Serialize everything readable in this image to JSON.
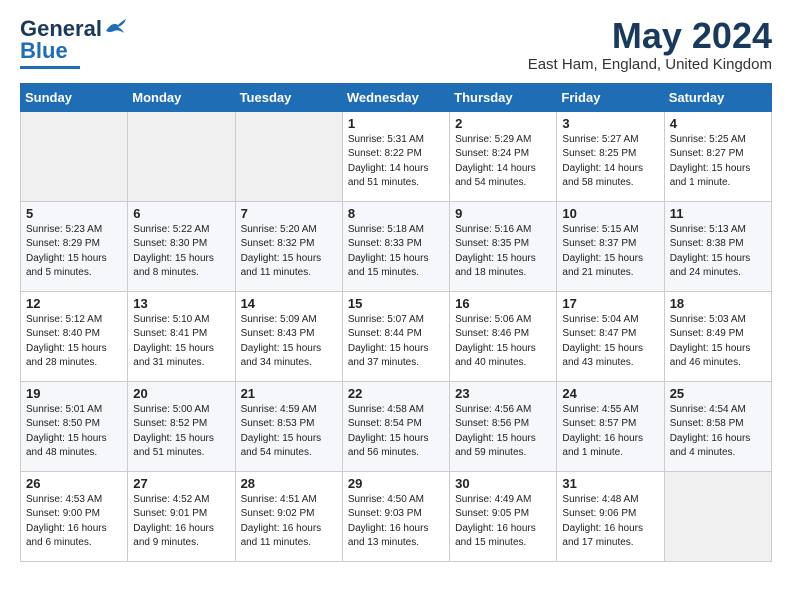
{
  "logo": {
    "line1": "General",
    "line2": "Blue"
  },
  "title": "May 2024",
  "location": "East Ham, England, United Kingdom",
  "days_of_week": [
    "Sunday",
    "Monday",
    "Tuesday",
    "Wednesday",
    "Thursday",
    "Friday",
    "Saturday"
  ],
  "weeks": [
    [
      {
        "day": "",
        "sunrise": "",
        "sunset": "",
        "daylight": ""
      },
      {
        "day": "",
        "sunrise": "",
        "sunset": "",
        "daylight": ""
      },
      {
        "day": "",
        "sunrise": "",
        "sunset": "",
        "daylight": ""
      },
      {
        "day": "1",
        "sunrise": "Sunrise: 5:31 AM",
        "sunset": "Sunset: 8:22 PM",
        "daylight": "Daylight: 14 hours and 51 minutes."
      },
      {
        "day": "2",
        "sunrise": "Sunrise: 5:29 AM",
        "sunset": "Sunset: 8:24 PM",
        "daylight": "Daylight: 14 hours and 54 minutes."
      },
      {
        "day": "3",
        "sunrise": "Sunrise: 5:27 AM",
        "sunset": "Sunset: 8:25 PM",
        "daylight": "Daylight: 14 hours and 58 minutes."
      },
      {
        "day": "4",
        "sunrise": "Sunrise: 5:25 AM",
        "sunset": "Sunset: 8:27 PM",
        "daylight": "Daylight: 15 hours and 1 minute."
      }
    ],
    [
      {
        "day": "5",
        "sunrise": "Sunrise: 5:23 AM",
        "sunset": "Sunset: 8:29 PM",
        "daylight": "Daylight: 15 hours and 5 minutes."
      },
      {
        "day": "6",
        "sunrise": "Sunrise: 5:22 AM",
        "sunset": "Sunset: 8:30 PM",
        "daylight": "Daylight: 15 hours and 8 minutes."
      },
      {
        "day": "7",
        "sunrise": "Sunrise: 5:20 AM",
        "sunset": "Sunset: 8:32 PM",
        "daylight": "Daylight: 15 hours and 11 minutes."
      },
      {
        "day": "8",
        "sunrise": "Sunrise: 5:18 AM",
        "sunset": "Sunset: 8:33 PM",
        "daylight": "Daylight: 15 hours and 15 minutes."
      },
      {
        "day": "9",
        "sunrise": "Sunrise: 5:16 AM",
        "sunset": "Sunset: 8:35 PM",
        "daylight": "Daylight: 15 hours and 18 minutes."
      },
      {
        "day": "10",
        "sunrise": "Sunrise: 5:15 AM",
        "sunset": "Sunset: 8:37 PM",
        "daylight": "Daylight: 15 hours and 21 minutes."
      },
      {
        "day": "11",
        "sunrise": "Sunrise: 5:13 AM",
        "sunset": "Sunset: 8:38 PM",
        "daylight": "Daylight: 15 hours and 24 minutes."
      }
    ],
    [
      {
        "day": "12",
        "sunrise": "Sunrise: 5:12 AM",
        "sunset": "Sunset: 8:40 PM",
        "daylight": "Daylight: 15 hours and 28 minutes."
      },
      {
        "day": "13",
        "sunrise": "Sunrise: 5:10 AM",
        "sunset": "Sunset: 8:41 PM",
        "daylight": "Daylight: 15 hours and 31 minutes."
      },
      {
        "day": "14",
        "sunrise": "Sunrise: 5:09 AM",
        "sunset": "Sunset: 8:43 PM",
        "daylight": "Daylight: 15 hours and 34 minutes."
      },
      {
        "day": "15",
        "sunrise": "Sunrise: 5:07 AM",
        "sunset": "Sunset: 8:44 PM",
        "daylight": "Daylight: 15 hours and 37 minutes."
      },
      {
        "day": "16",
        "sunrise": "Sunrise: 5:06 AM",
        "sunset": "Sunset: 8:46 PM",
        "daylight": "Daylight: 15 hours and 40 minutes."
      },
      {
        "day": "17",
        "sunrise": "Sunrise: 5:04 AM",
        "sunset": "Sunset: 8:47 PM",
        "daylight": "Daylight: 15 hours and 43 minutes."
      },
      {
        "day": "18",
        "sunrise": "Sunrise: 5:03 AM",
        "sunset": "Sunset: 8:49 PM",
        "daylight": "Daylight: 15 hours and 46 minutes."
      }
    ],
    [
      {
        "day": "19",
        "sunrise": "Sunrise: 5:01 AM",
        "sunset": "Sunset: 8:50 PM",
        "daylight": "Daylight: 15 hours and 48 minutes."
      },
      {
        "day": "20",
        "sunrise": "Sunrise: 5:00 AM",
        "sunset": "Sunset: 8:52 PM",
        "daylight": "Daylight: 15 hours and 51 minutes."
      },
      {
        "day": "21",
        "sunrise": "Sunrise: 4:59 AM",
        "sunset": "Sunset: 8:53 PM",
        "daylight": "Daylight: 15 hours and 54 minutes."
      },
      {
        "day": "22",
        "sunrise": "Sunrise: 4:58 AM",
        "sunset": "Sunset: 8:54 PM",
        "daylight": "Daylight: 15 hours and 56 minutes."
      },
      {
        "day": "23",
        "sunrise": "Sunrise: 4:56 AM",
        "sunset": "Sunset: 8:56 PM",
        "daylight": "Daylight: 15 hours and 59 minutes."
      },
      {
        "day": "24",
        "sunrise": "Sunrise: 4:55 AM",
        "sunset": "Sunset: 8:57 PM",
        "daylight": "Daylight: 16 hours and 1 minute."
      },
      {
        "day": "25",
        "sunrise": "Sunrise: 4:54 AM",
        "sunset": "Sunset: 8:58 PM",
        "daylight": "Daylight: 16 hours and 4 minutes."
      }
    ],
    [
      {
        "day": "26",
        "sunrise": "Sunrise: 4:53 AM",
        "sunset": "Sunset: 9:00 PM",
        "daylight": "Daylight: 16 hours and 6 minutes."
      },
      {
        "day": "27",
        "sunrise": "Sunrise: 4:52 AM",
        "sunset": "Sunset: 9:01 PM",
        "daylight": "Daylight: 16 hours and 9 minutes."
      },
      {
        "day": "28",
        "sunrise": "Sunrise: 4:51 AM",
        "sunset": "Sunset: 9:02 PM",
        "daylight": "Daylight: 16 hours and 11 minutes."
      },
      {
        "day": "29",
        "sunrise": "Sunrise: 4:50 AM",
        "sunset": "Sunset: 9:03 PM",
        "daylight": "Daylight: 16 hours and 13 minutes."
      },
      {
        "day": "30",
        "sunrise": "Sunrise: 4:49 AM",
        "sunset": "Sunset: 9:05 PM",
        "daylight": "Daylight: 16 hours and 15 minutes."
      },
      {
        "day": "31",
        "sunrise": "Sunrise: 4:48 AM",
        "sunset": "Sunset: 9:06 PM",
        "daylight": "Daylight: 16 hours and 17 minutes."
      },
      {
        "day": "",
        "sunrise": "",
        "sunset": "",
        "daylight": ""
      }
    ]
  ]
}
